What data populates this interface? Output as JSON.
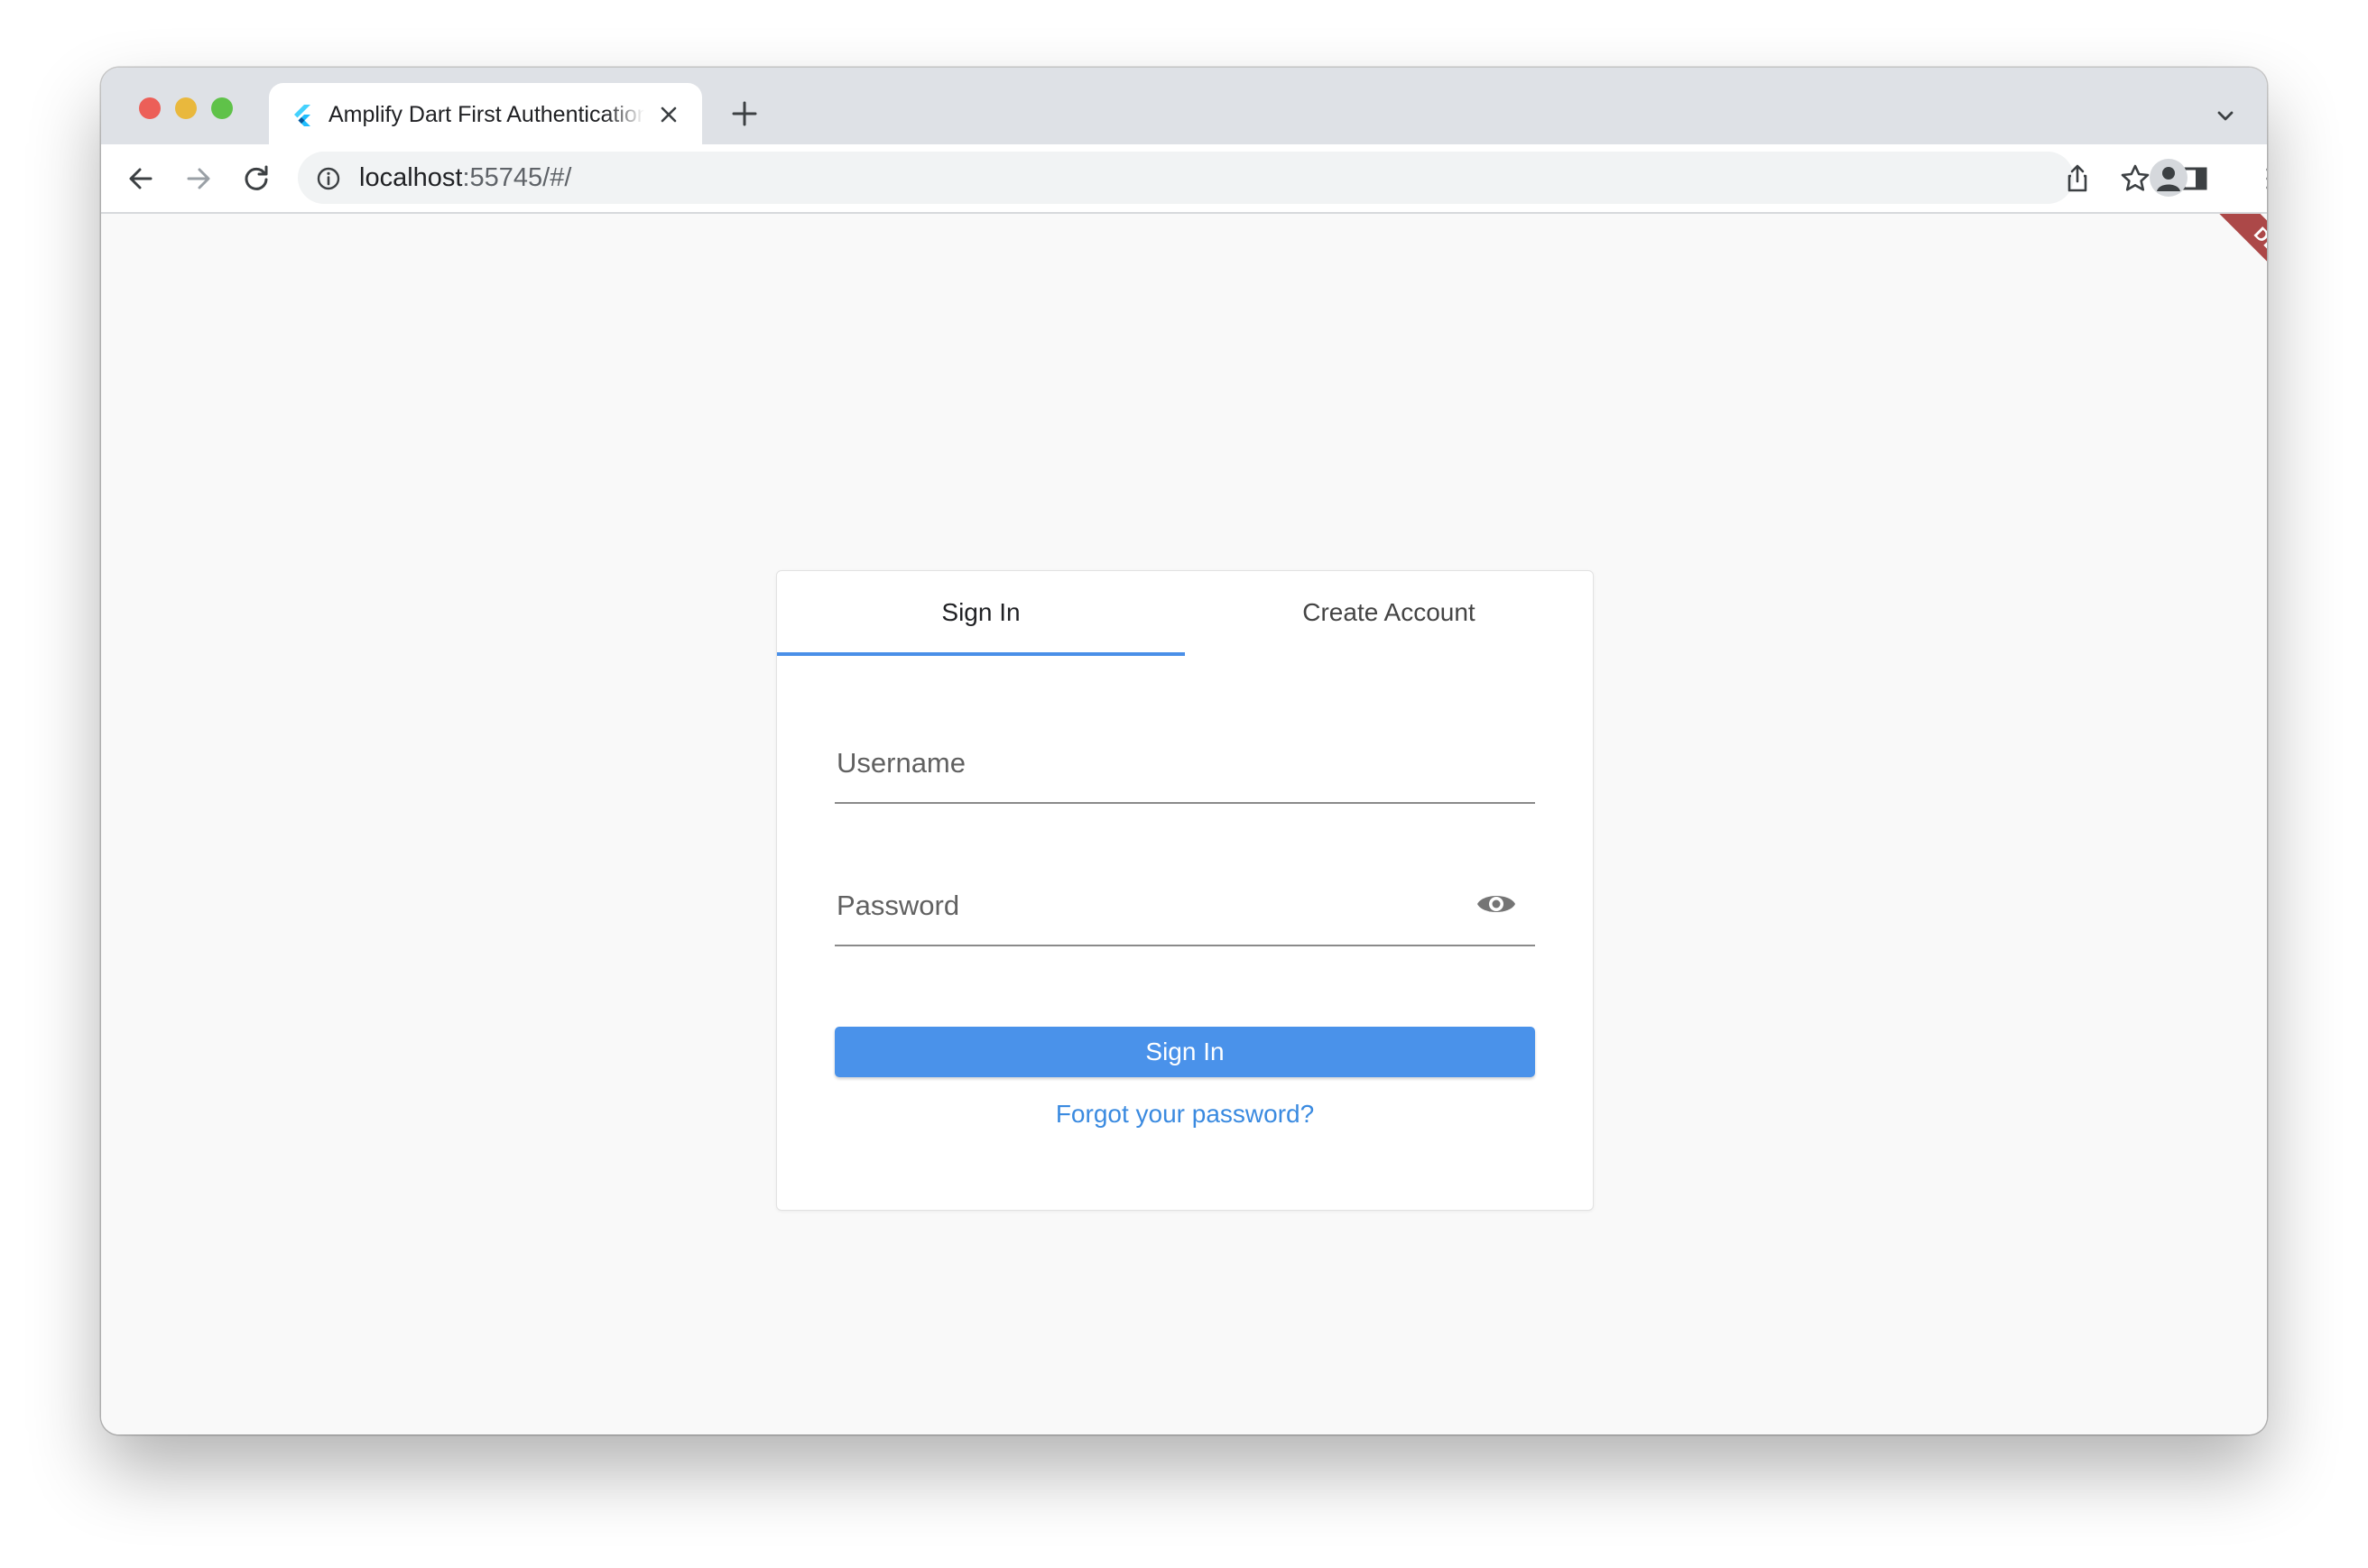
{
  "browser": {
    "tab": {
      "title": "Amplify Dart First Authentication",
      "favicon_icon": "flutter-logo-icon"
    },
    "address": {
      "host": "localhost",
      "path": ":55745/#/"
    },
    "icons": [
      "back-icon",
      "forward-icon",
      "reload-icon",
      "info-icon",
      "share-icon",
      "star-icon",
      "side-panel-icon",
      "profile-icon",
      "menu-icon",
      "new-tab-icon",
      "tab-search-icon",
      "close-icon"
    ]
  },
  "debug_banner": "DEBUG",
  "auth": {
    "tabs": {
      "sign_in": "Sign In",
      "create_account": "Create Account"
    },
    "username": {
      "placeholder": "Username",
      "value": ""
    },
    "password": {
      "placeholder": "Password",
      "value": ""
    },
    "sign_in_button": "Sign In",
    "forgot_password": "Forgot your password?"
  },
  "colors": {
    "accent": "#4a92ea",
    "link": "#3a8ae0",
    "debug_banner": "#9f2a2a"
  }
}
